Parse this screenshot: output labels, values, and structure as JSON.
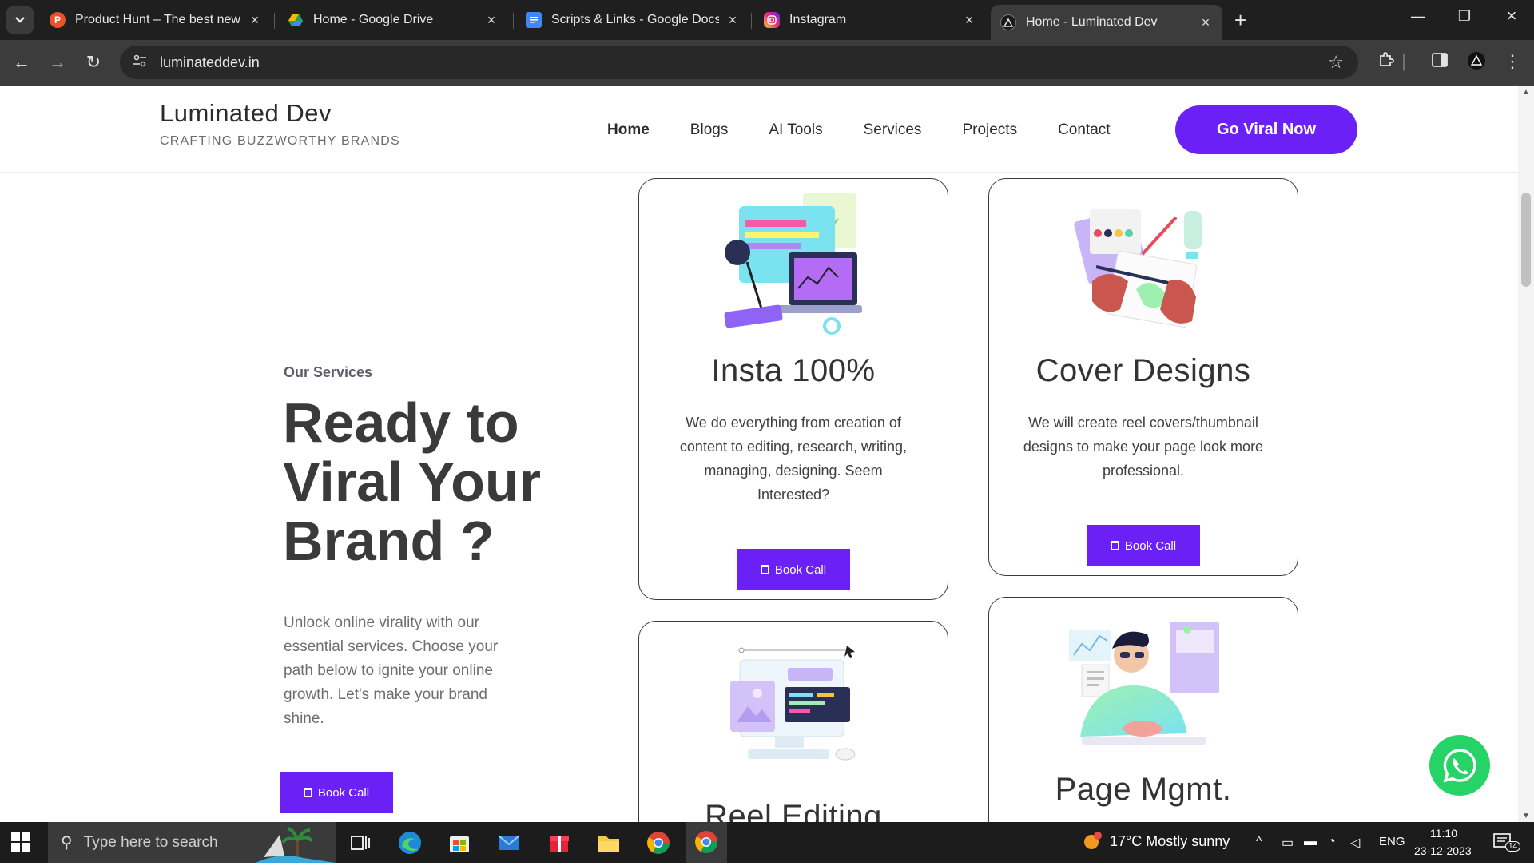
{
  "tabs": [
    {
      "title": "Product Hunt – The best new pr",
      "favicon_color": "#ea532a",
      "favicon_glyph": "P"
    },
    {
      "title": "Home - Google Drive",
      "favicon_color": "#1fa463",
      "favicon_glyph": "drive-icon"
    },
    {
      "title": "Scripts & Links - Google Docs",
      "favicon_color": "#4285f4",
      "favicon_glyph": "docs-icon"
    },
    {
      "title": "Instagram",
      "favicon_color": "#e1306c",
      "favicon_glyph": "instagram-icon"
    },
    {
      "title": "Home - Luminated Dev",
      "favicon_color": "#222222",
      "favicon_glyph": "triangle-icon"
    }
  ],
  "address_bar": {
    "url": "luminateddev.in"
  },
  "site": {
    "brand": "Luminated Dev",
    "tagline": "CRAFTING BUZZWORTHY BRANDS",
    "nav": [
      "Home",
      "Blogs",
      "AI Tools",
      "Services",
      "Projects",
      "Contact"
    ],
    "cta": "Go Viral Now"
  },
  "hero": {
    "subtitle": "Our Services",
    "title": "Ready to Viral Your Brand ?",
    "description": "Unlock online virality with our essential services. Choose your path below to ignite your online growth. Let's make your brand shine.",
    "button": "Book Call"
  },
  "cards": [
    {
      "title": "Insta 100%",
      "description": "We do everything from creation of content to editing, research, writing, managing, designing. Seem Interested?",
      "button": "Book Call"
    },
    {
      "title": "Cover Designs",
      "description": "We will create reel covers/thumbnail designs to make your page look more professional.",
      "button": "Book Call"
    },
    {
      "title": "Reel Editing"
    },
    {
      "title": "Page Mgmt."
    }
  ],
  "taskbar": {
    "search_placeholder": "Type here to search",
    "weather": "17°C  Mostly sunny",
    "language": "ENG",
    "time": "11:10",
    "date": "23-12-2023",
    "notifications": "14"
  },
  "colors": {
    "brand_purple": "#6b21f5",
    "whatsapp_green": "#26d367",
    "chrome_dark": "#1f1f1f"
  }
}
